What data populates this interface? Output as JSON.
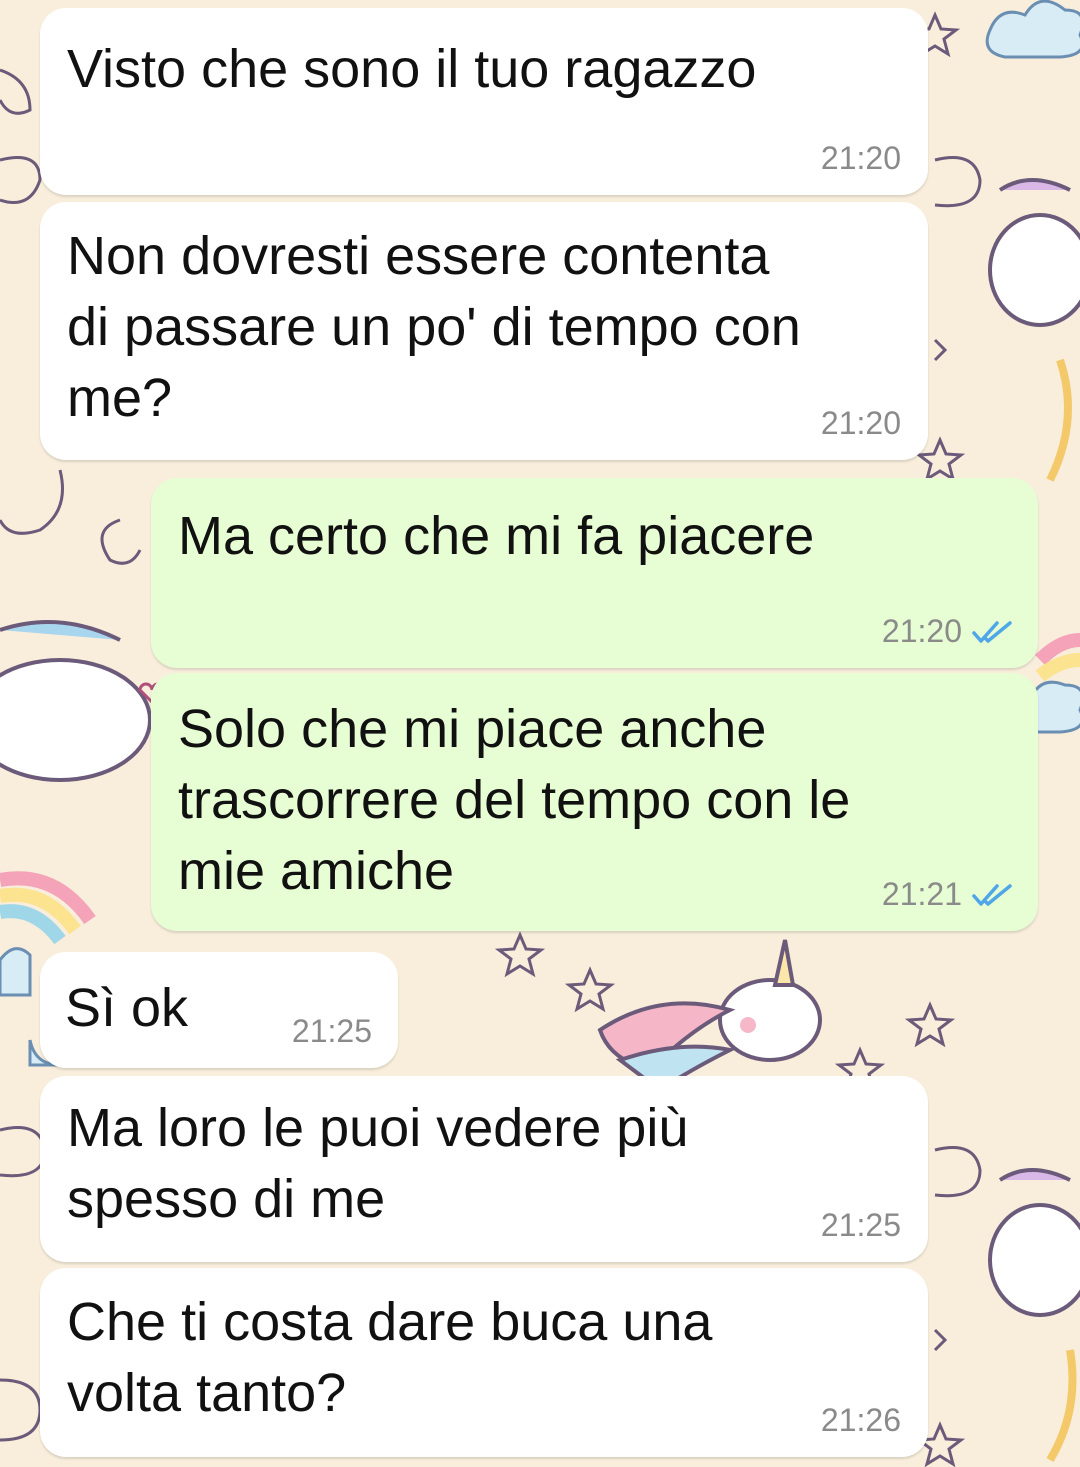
{
  "chat": {
    "messages": [
      {
        "direction": "incoming",
        "text": "Visto che sono il tuo ragazzo",
        "time": "21:20"
      },
      {
        "direction": "incoming",
        "text": "Non dovresti essere contenta\ndi passare un po' di tempo con\nme?",
        "time": "21:20"
      },
      {
        "direction": "outgoing",
        "text": "Ma certo che mi fa piacere",
        "time": "21:20",
        "status": "read"
      },
      {
        "direction": "outgoing",
        "text": "Solo che mi piace anche\ntrascorrere del tempo con le\nmie amiche",
        "time": "21:21",
        "status": "read"
      },
      {
        "direction": "incoming",
        "text": "Sì ok",
        "time": "21:25"
      },
      {
        "direction": "incoming",
        "text": "Ma loro le puoi vedere più\nspesso di me",
        "time": "21:25"
      },
      {
        "direction": "incoming",
        "text": "Che ti costa dare buca una\nvolta tanto?",
        "time": "21:26"
      }
    ]
  },
  "theme": {
    "incoming_bubble": "#ffffff",
    "outgoing_bubble": "#e7fdd3",
    "read_tick_color": "#4fa7e8",
    "wallpaper": "#f8eedb",
    "wallpaper_motif": "unicorns-rainbows-stars"
  },
  "icons": {
    "read_status": "double-check-icon"
  }
}
